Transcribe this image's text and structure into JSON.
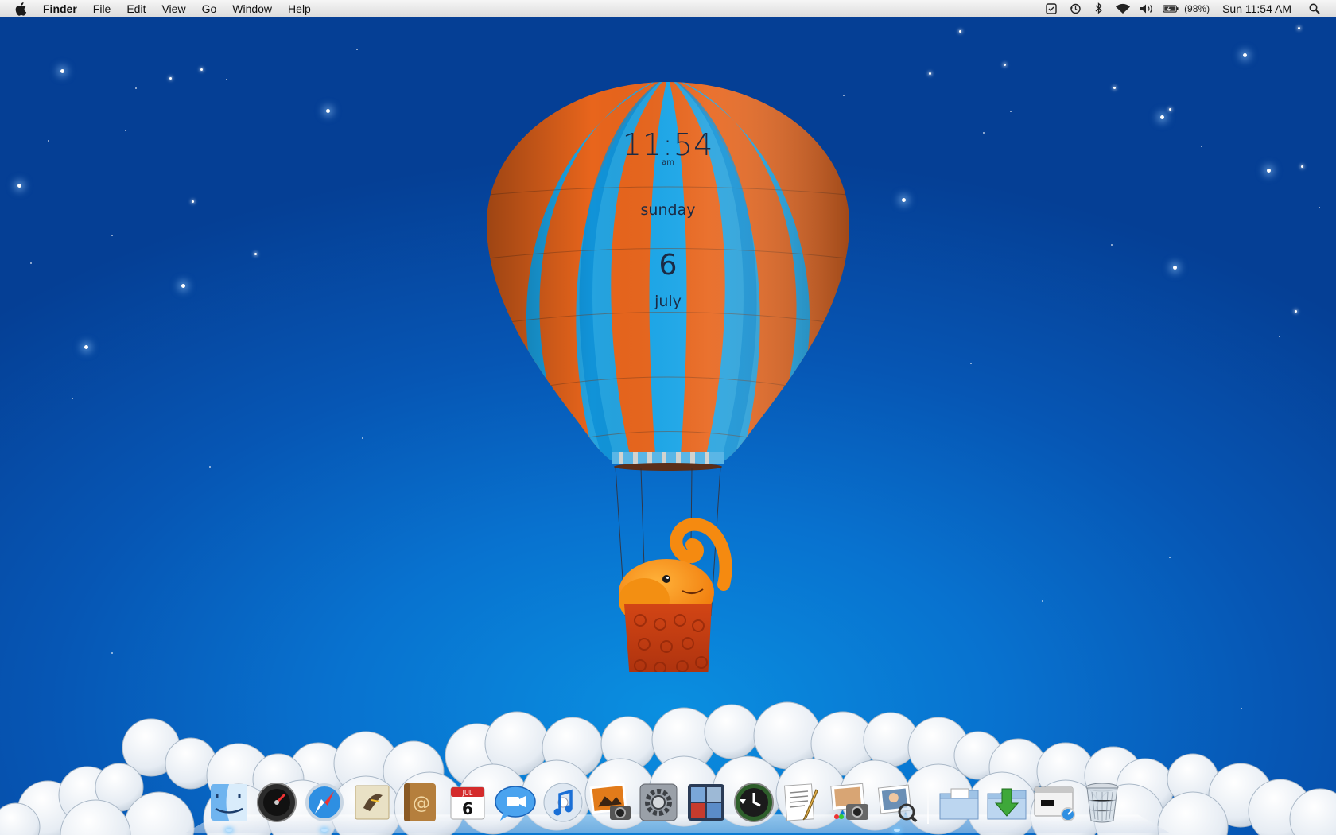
{
  "menubar": {
    "app_name": "Finder",
    "menus": [
      "File",
      "Edit",
      "View",
      "Go",
      "Window",
      "Help"
    ],
    "status_icons": [
      "time-machine-status-icon",
      "time-machine-clock-icon",
      "bluetooth-icon",
      "wifi-icon",
      "volume-icon",
      "battery-icon",
      "spotlight-icon"
    ],
    "battery_percent": "(98%)",
    "clock": "Sun 11:54 AM"
  },
  "widget": {
    "time": "11:54",
    "ampm": "am",
    "weekday": "sunday",
    "date": "6",
    "month": "july",
    "colors": {
      "stripe_orange": "#e8651c",
      "stripe_blue": "#1aa7ea"
    }
  },
  "dock": {
    "items": [
      {
        "name": "finder-icon",
        "running": true
      },
      {
        "name": "dashboard-icon",
        "running": false
      },
      {
        "name": "safari-icon",
        "running": true
      },
      {
        "name": "mail-icon",
        "running": false
      },
      {
        "name": "address-book-icon",
        "running": false
      },
      {
        "name": "ical-icon",
        "running": false,
        "month": "JUL",
        "day": "6"
      },
      {
        "name": "ichat-icon",
        "running": false
      },
      {
        "name": "itunes-icon",
        "running": false
      },
      {
        "name": "iphoto-icon",
        "running": false
      },
      {
        "name": "system-preferences-icon",
        "running": false
      },
      {
        "name": "spaces-icon",
        "running": false
      },
      {
        "name": "time-machine-icon",
        "running": false
      },
      {
        "name": "textedit-icon",
        "running": false
      },
      {
        "name": "photo-booth-icon",
        "running": false
      },
      {
        "name": "preview-icon",
        "running": true
      }
    ],
    "stacks": [
      {
        "name": "documents-stack-icon"
      },
      {
        "name": "downloads-stack-icon"
      },
      {
        "name": "window-stack-icon"
      },
      {
        "name": "trash-icon"
      }
    ]
  }
}
